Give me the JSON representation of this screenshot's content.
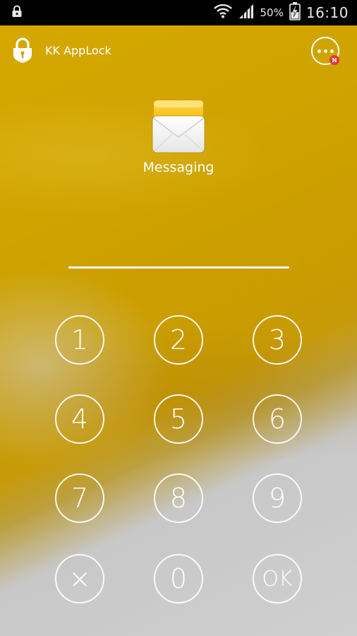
{
  "status_bar": {
    "battery_percent": "50%",
    "time": "16:10"
  },
  "header": {
    "app_title": "KK AppLock",
    "menu_badge": "N"
  },
  "locked_app": {
    "name": "Messaging",
    "icon": "messaging-envelope-icon"
  },
  "keypad": {
    "keys": [
      "1",
      "2",
      "3",
      "4",
      "5",
      "6",
      "7",
      "8",
      "9",
      "×",
      "0",
      "OK"
    ]
  },
  "colors": {
    "accent_yellow": "#cfa300",
    "badge_red": "#e53935"
  }
}
